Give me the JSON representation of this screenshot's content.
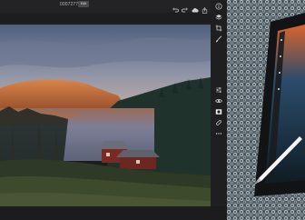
{
  "header": {
    "document_name": "0007277",
    "document_badge": "Edit"
  },
  "toolbar": {
    "top_icons": [
      "undo-icon",
      "redo-icon",
      "cloud-icon",
      "share-icon",
      "help-icon"
    ]
  },
  "right_rail": {
    "tools": [
      "info-icon",
      "layers-icon",
      "crop-icon",
      "brush-icon",
      "sliders-icon",
      "eye-icon",
      "mask-icon",
      "heal-icon",
      "more-icon"
    ]
  },
  "colors": {
    "app_background": "#1d1d1f",
    "sky_top": "#5b6a86",
    "sky_bottom": "#b6a9a7",
    "hill_lit": "#c86e3a",
    "forest": "#20342e",
    "water": "#7b7f93",
    "cabin_roof": "#6b6e76",
    "cabin_wall": "#7a2a24",
    "stylus": "#f5f5f5",
    "scene_surface": "#5f6a6e"
  }
}
